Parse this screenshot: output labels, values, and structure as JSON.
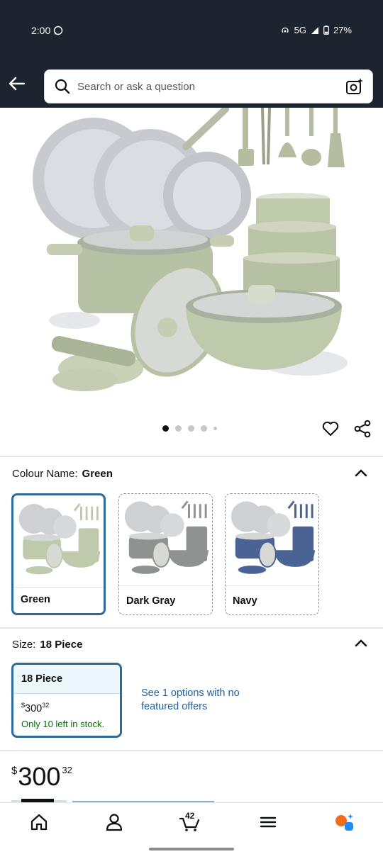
{
  "status_bar": {
    "time": "2:00",
    "network": "5G",
    "battery": "27%"
  },
  "search": {
    "placeholder": "Search or ask a question"
  },
  "gallery": {
    "image_count": 5,
    "active_index": 0
  },
  "colour": {
    "label": "Colour Name:",
    "selected": "Green",
    "options": [
      {
        "name": "Green",
        "color": "#bfc9ac",
        "selected": true
      },
      {
        "name": "Dark Gray",
        "color": "#8f9291",
        "selected": false
      },
      {
        "name": "Navy",
        "color": "#4b6394",
        "selected": false
      }
    ]
  },
  "size": {
    "label": "Size:",
    "selected": "18 Piece",
    "option": {
      "name": "18 Piece",
      "currency": "$",
      "price_whole": "300",
      "price_fraction": "32",
      "stock": "Only 10 left in stock."
    },
    "other_offers": "See 1 options with no featured offers"
  },
  "price": {
    "currency": "$",
    "whole": "300",
    "fraction": "32"
  },
  "nav": {
    "cart_count": "42"
  },
  "colors": {
    "accent": "#2d6b9a",
    "header_bg": "#1c2430",
    "in_stock": "#007600",
    "link": "#2162a1"
  }
}
